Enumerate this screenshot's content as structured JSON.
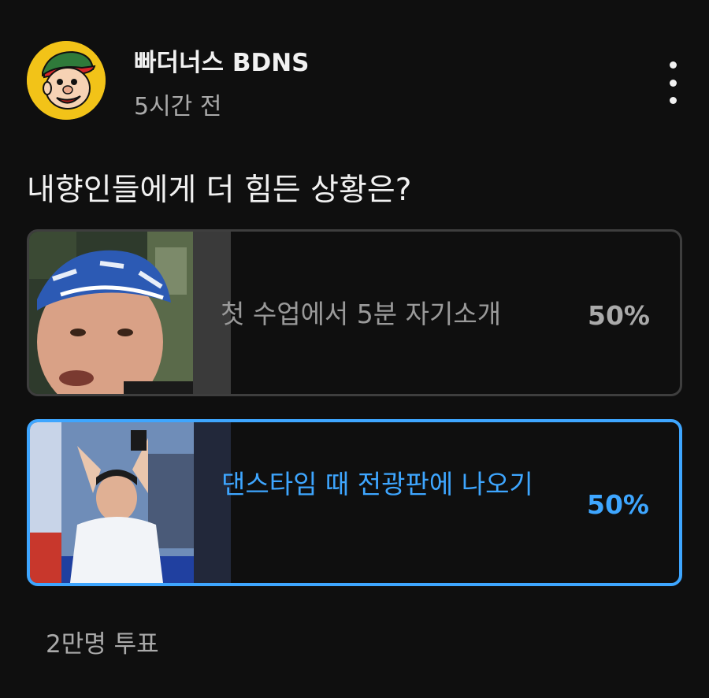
{
  "post": {
    "channel_name": "빠더너스 BDNS",
    "time_ago": "5시간 전",
    "more_icon": "more-vert-icon"
  },
  "poll": {
    "question": "내향인들에게 더 힘든 상황은?",
    "options": [
      {
        "label": "첫 수업에서 5분 자기소개",
        "percent_text": "50%",
        "percent": 50,
        "selected": false
      },
      {
        "label": "댄스타임 때 전광판에 나오기",
        "percent_text": "50%",
        "percent": 50,
        "selected": true
      }
    ],
    "vote_count": "2만명 투표"
  },
  "colors": {
    "background": "#0f0f0f",
    "accent": "#3ea6ff",
    "avatar_yellow": "#f2c318",
    "unselected_fill": "#3a3a3a",
    "selected_fill": "#22283a"
  }
}
